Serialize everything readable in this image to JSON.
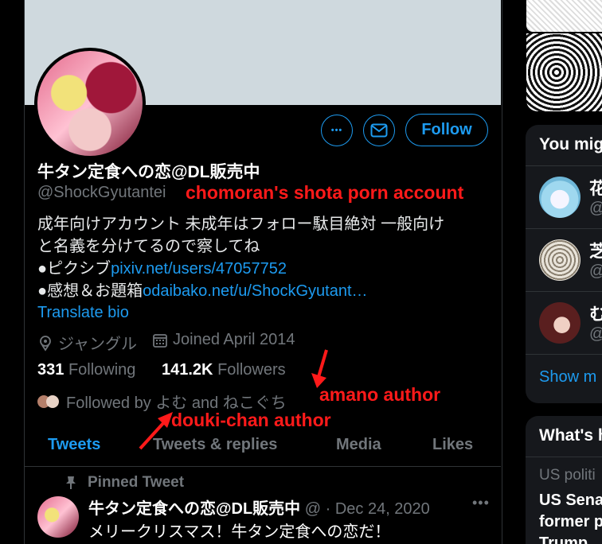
{
  "profile": {
    "display_name": "牛タン定食への恋@DL販売中",
    "handle": "@ShockGyutantei",
    "bio_line1": "成年向けアカウント 未成年はフォロー駄目絶対 一般向け",
    "bio_line2": "と名義を分けてるので察してね",
    "bio_pixiv_prefix": "●ピクシブ",
    "bio_pixiv_link": "pixiv.net/users/47057752",
    "bio_odaibako_prefix": "●感想＆お題箱",
    "bio_odaibako_link": "odaibako.net/u/ShockGyutant…",
    "translate_bio": "Translate bio",
    "location": "ジャングル",
    "joined": "Joined April 2014",
    "following_count": "331",
    "following_label": "Following",
    "followers_count": "141.2K",
    "followers_label": "Followers",
    "followed_by": "Followed by よむ and ねこぐち"
  },
  "actions": {
    "more_label": "•••",
    "follow_label": "Follow"
  },
  "annotations": {
    "account_note": "chomoran's shota porn account",
    "amano_note": "amano author",
    "douki_note": "douki-chan author",
    "color": "#ff1a1a"
  },
  "tabs": [
    "Tweets",
    "Tweets & replies",
    "Media",
    "Likes"
  ],
  "pinned_tweet": {
    "pinned_label": "Pinned Tweet",
    "author_name": "牛タン定食への恋@DL販売中",
    "author_handle": "@",
    "date": "· Dec 24, 2020",
    "text": "メリークリスマス！牛タン定食への恋だ！",
    "more": "•••"
  },
  "sidebar": {
    "suggest_title": "You mig",
    "suggestions": [
      {
        "name": "花",
        "handle": "@"
      },
      {
        "name": "芝",
        "handle": "@"
      },
      {
        "name": "む",
        "handle": "@"
      }
    ],
    "show_more": "Show m",
    "trends_title": "What's h",
    "trend_category": "US politi",
    "trend_line1": "US Sena",
    "trend_line2": "former p",
    "trend_line3": "Trump"
  },
  "icons": [
    "more-icon",
    "mail-icon",
    "location-icon",
    "calendar-icon",
    "pin-icon",
    "arrow-icon"
  ]
}
